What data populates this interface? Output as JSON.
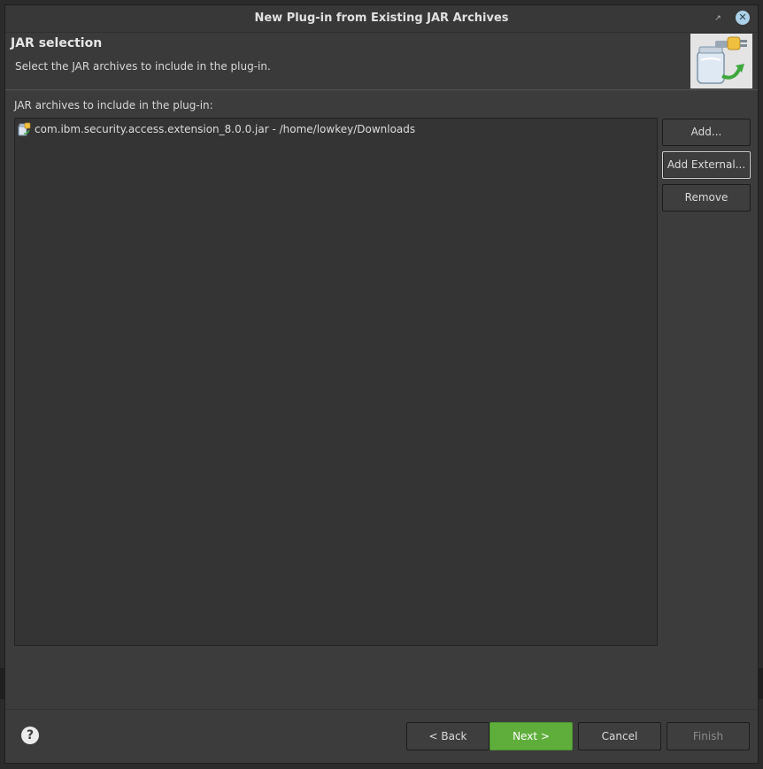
{
  "window": {
    "title": "New Plug-in from Existing JAR Archives"
  },
  "header": {
    "page_title": "JAR selection",
    "description": "Select the JAR archives to include in the plug-in."
  },
  "list": {
    "label": "JAR archives to include in the plug-in:",
    "items": [
      {
        "text": "com.ibm.security.access.extension_8.0.0.jar - /home/lowkey/Downloads",
        "icon": "jar-file-icon"
      }
    ]
  },
  "side_buttons": {
    "add": "Add...",
    "add_external": "Add External...",
    "remove": "Remove"
  },
  "footer": {
    "back": "< Back",
    "next": "Next >",
    "cancel": "Cancel",
    "finish": "Finish"
  },
  "colors": {
    "primary_button": "#5fae3c",
    "dialog_bg": "#3c3c3c",
    "list_bg": "#343434"
  }
}
